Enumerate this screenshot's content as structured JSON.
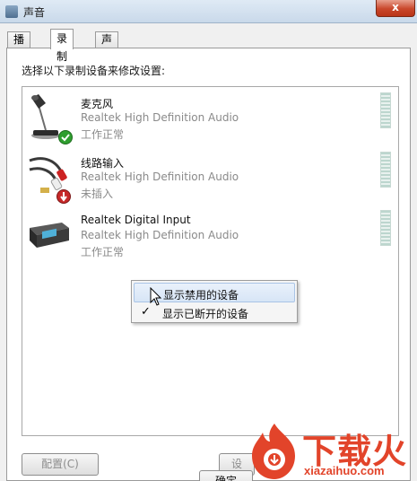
{
  "window": {
    "title": "声音",
    "close_label": "x"
  },
  "tabs": [
    {
      "label": "播放"
    },
    {
      "label": "录制"
    },
    {
      "label": "声音"
    }
  ],
  "instruction": "选择以下录制设备来修改设置:",
  "devices": [
    {
      "name": "麦克风",
      "driver": "Realtek High Definition Audio",
      "status": "工作正常",
      "icon": "microphone-icon",
      "badge": "check-badge"
    },
    {
      "name": "线路输入",
      "driver": "Realtek High Definition Audio",
      "status": "未插入",
      "icon": "audio-cable-icon",
      "badge": "unplugged-badge"
    },
    {
      "name": "Realtek Digital Input",
      "driver": "Realtek High Definition Audio",
      "status": "工作正常",
      "icon": "digital-input-device-icon"
    }
  ],
  "context_menu": {
    "items": [
      {
        "label": "显示禁用的设备",
        "checked": false,
        "highlighted": true
      },
      {
        "label": "显示已断开的设备",
        "checked": true,
        "highlighted": false
      }
    ]
  },
  "buttons": {
    "configure": "配置(C)",
    "set_default": "设",
    "ok": "确定"
  },
  "watermark": {
    "logo_text": "下载火",
    "site": "xiazaihuo.com"
  },
  "colors": {
    "accent": "#e2442a",
    "disabled_text": "#8c8c8c"
  }
}
